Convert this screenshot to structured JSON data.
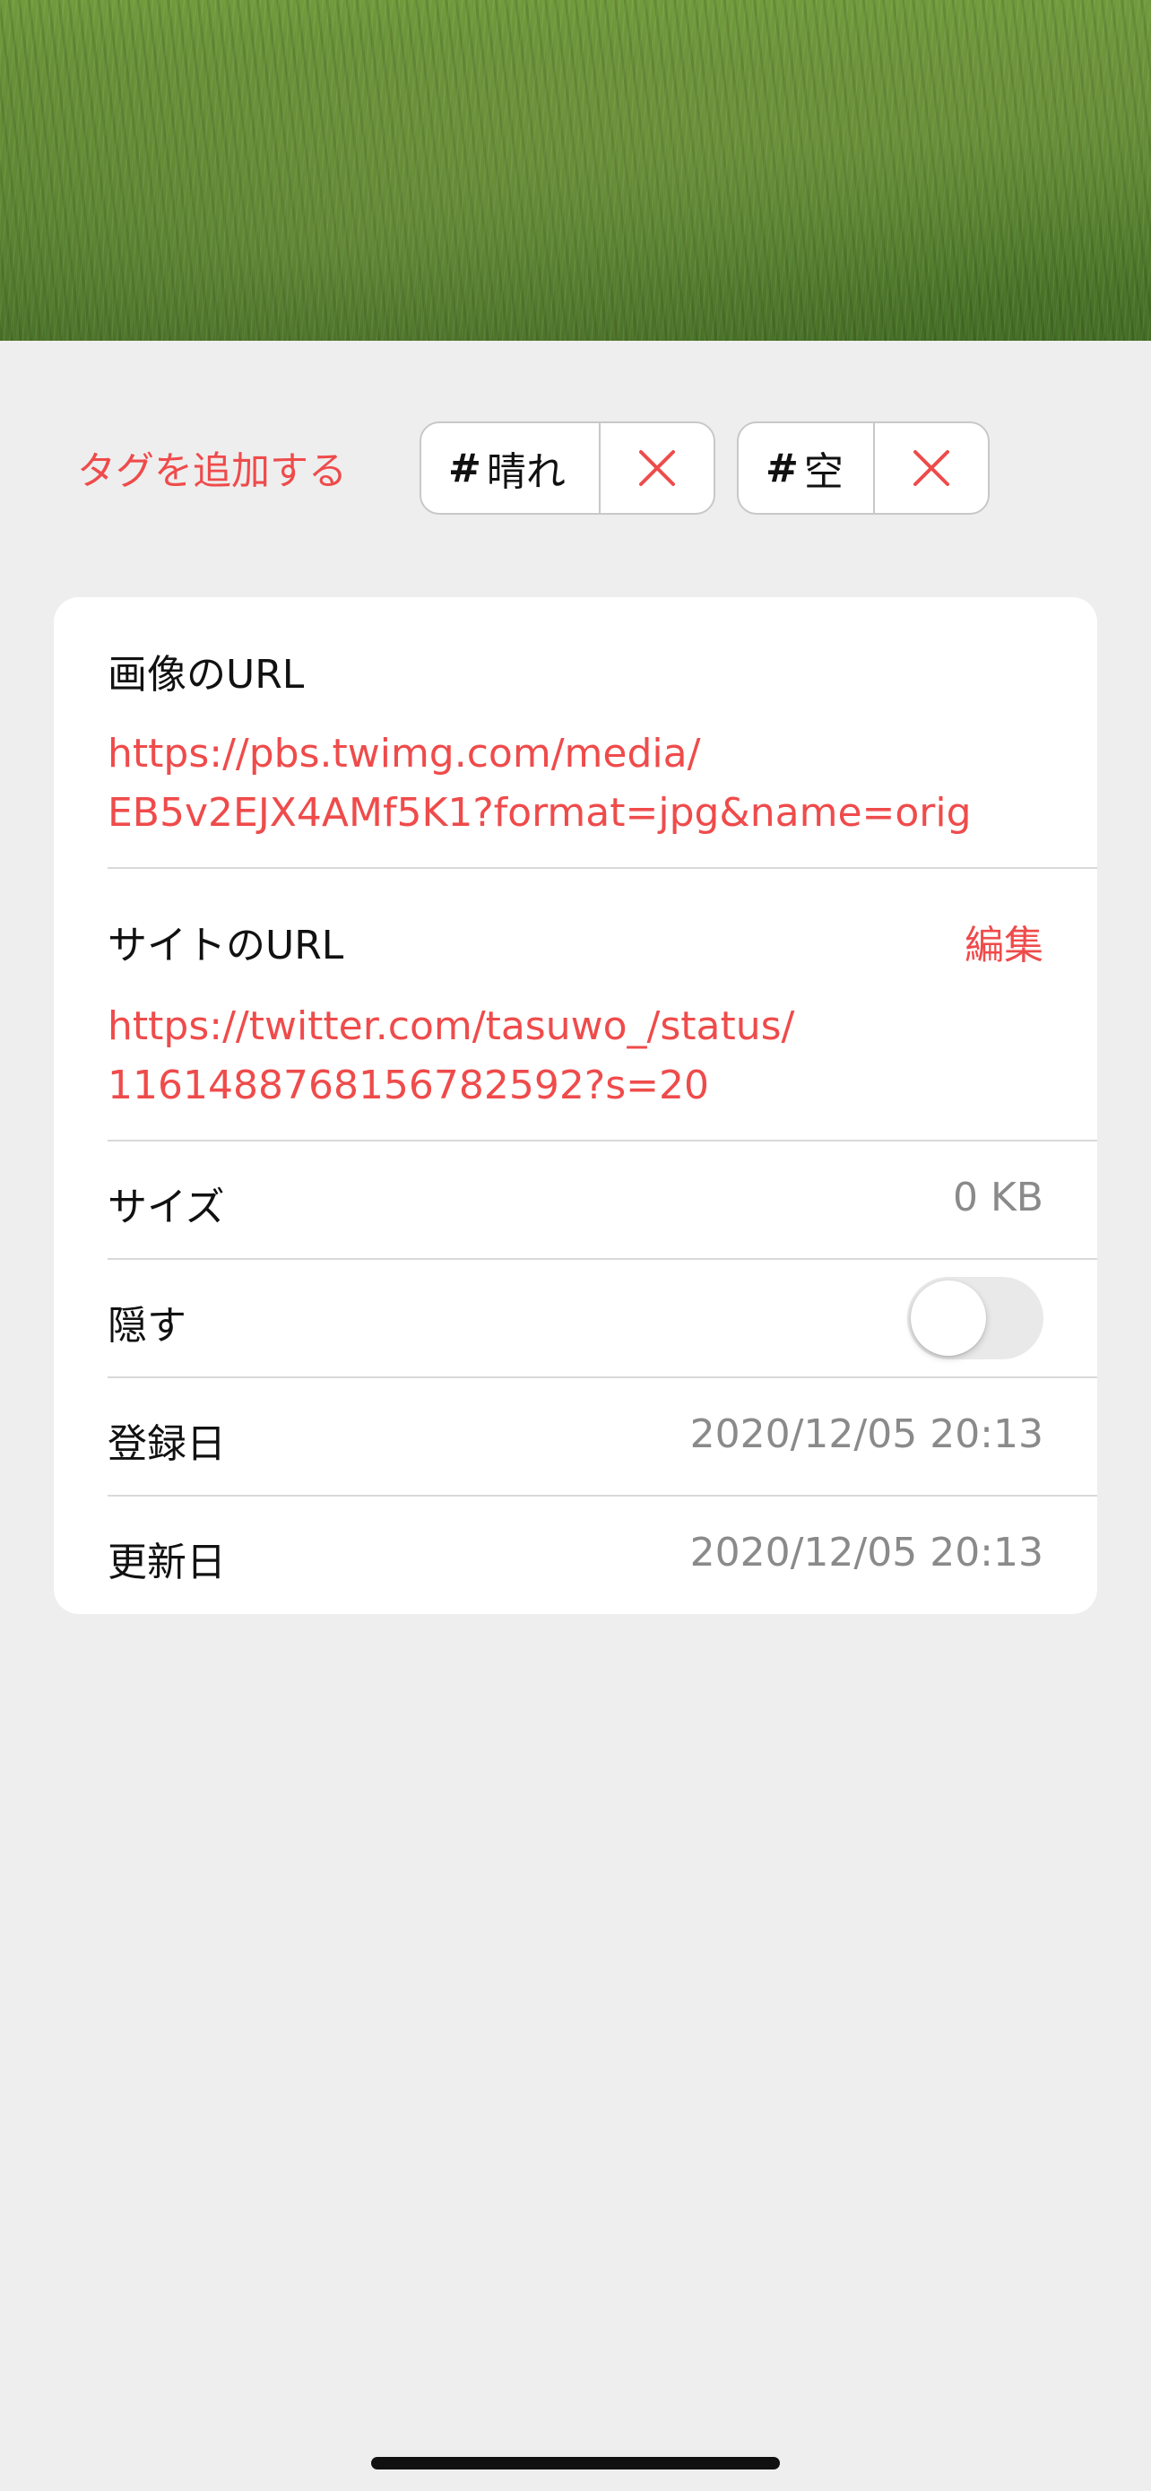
{
  "hero": {
    "image_icon": "photo-rice-field"
  },
  "tags": {
    "add_label": "タグを追加する",
    "items": [
      {
        "hash": "#",
        "name": "晴れ",
        "remove_icon": "close-icon"
      },
      {
        "hash": "#",
        "name": "空",
        "remove_icon": "close-icon"
      }
    ]
  },
  "info": {
    "image_url": {
      "label": "画像のURL",
      "line1": "https://pbs.twimg.com/media/",
      "line2": "EB5v2EJX4AMf5K1?format=jpg&name=orig"
    },
    "site_url": {
      "label": "サイトのURL",
      "edit_label": "編集",
      "line1": "https://twitter.com/tasuwo_/status/",
      "line2": "1161488768156782592?s=20"
    },
    "size": {
      "label": "サイズ",
      "value": "0 KB"
    },
    "hide": {
      "label": "隠す",
      "on": false
    },
    "created": {
      "label": "登録日",
      "value": "2020/12/05 20:13"
    },
    "updated": {
      "label": "更新日",
      "value": "2020/12/05 20:13"
    }
  },
  "colors": {
    "accent": "#ef4b4b",
    "background": "#eeeeee",
    "secondary_text": "#8a8a8a"
  }
}
